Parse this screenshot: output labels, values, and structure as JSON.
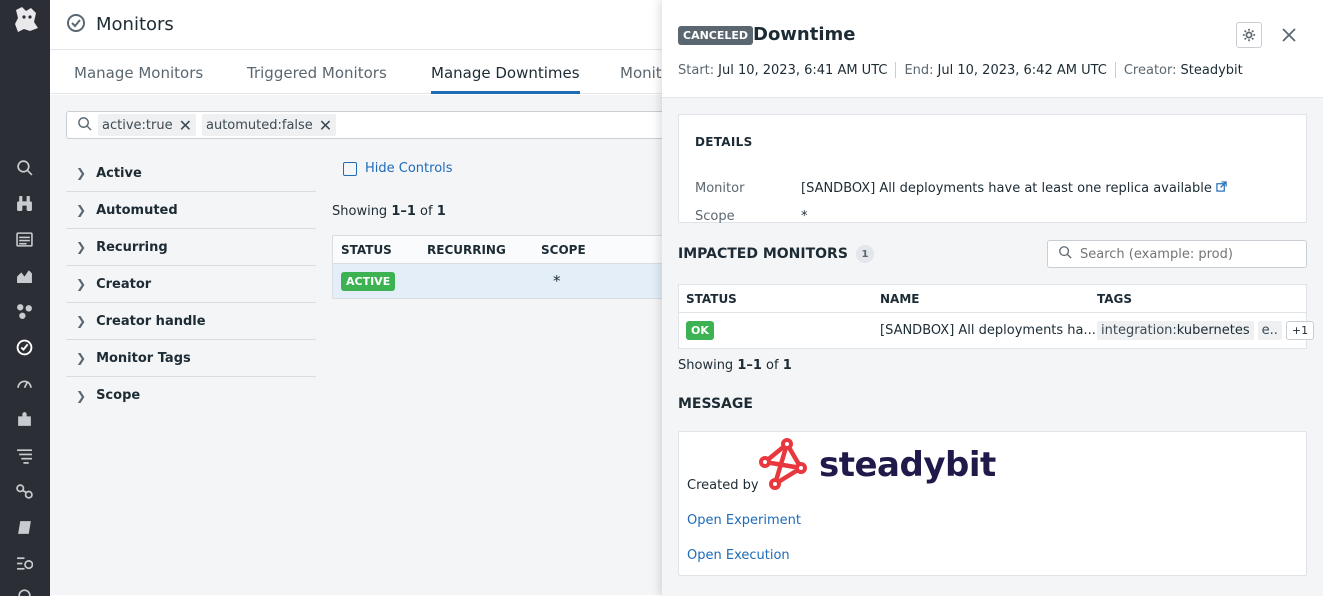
{
  "app": {
    "title": "Monitors"
  },
  "tabs": [
    "Manage Monitors",
    "Triggered Monitors",
    "Manage Downtimes",
    "Monit"
  ],
  "search_chips": [
    "active:true",
    "automuted:false"
  ],
  "facets": [
    "Active",
    "Automuted",
    "Recurring",
    "Creator",
    "Creator handle",
    "Monitor Tags",
    "Scope"
  ],
  "list": {
    "hide_controls": "Hide Controls",
    "showing": {
      "prefix": "Showing ",
      "range": "1–1",
      "of": " of ",
      "total": "1"
    },
    "columns": [
      "STATUS",
      "RECURRING",
      "SCOPE"
    ],
    "rows": [
      {
        "status": "ACTIVE",
        "recurring": "",
        "scope": "*"
      }
    ]
  },
  "panel": {
    "status_badge": "CANCELED",
    "title": "Downtime",
    "start_label": "Start:",
    "start_value": "Jul 10, 2023, 6:41 AM UTC",
    "end_label": "End:",
    "end_value": "Jul 10, 2023, 6:42 AM UTC",
    "creator_label": "Creator:",
    "creator_value": "Steadybit",
    "details": {
      "heading": "DETAILS",
      "monitor_label": "Monitor",
      "monitor_value": "[SANDBOX] All deployments have at least one replica available",
      "scope_label": "Scope",
      "scope_value": "*"
    },
    "impacted": {
      "heading": "IMPACTED MONITORS",
      "count": "1",
      "search_placeholder": "Search (example: prod)",
      "columns": [
        "STATUS",
        "NAME",
        "TAGS"
      ],
      "rows": [
        {
          "status": "OK",
          "name": "[SANDBOX] All deployments ha...",
          "tag_key": "integration:",
          "tag_value": "kubernetes",
          "tag_more": "e..",
          "extra": "+1"
        }
      ],
      "showing": {
        "prefix": "Showing ",
        "range": "1–1",
        "of": " of ",
        "total": "1"
      }
    },
    "message": {
      "heading": "MESSAGE",
      "created_by": "Created by",
      "brand": "steadybit",
      "link1": "Open Experiment",
      "link2": "Open Execution"
    }
  },
  "colors": {
    "accent": "#1e6bb8",
    "ok_green": "#3db252",
    "nav_bg": "#2b2e35",
    "brand_red": "#e8383d",
    "brand_navy": "#1f1a4a"
  }
}
